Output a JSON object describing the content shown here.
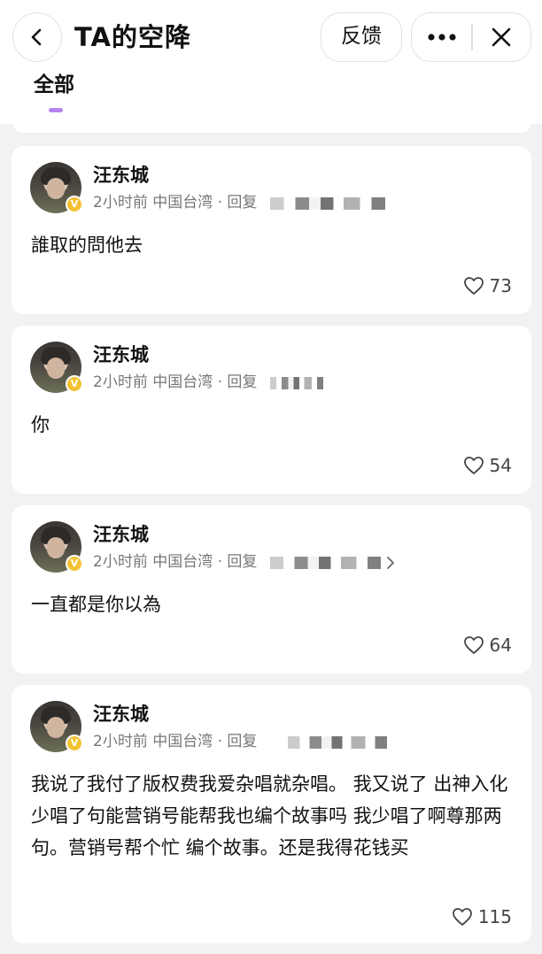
{
  "header": {
    "title": "TA的空降",
    "feedback_label": "反馈",
    "tabs": [
      {
        "label": "全部",
        "active": true
      }
    ]
  },
  "colors": {
    "accent": "#b583ee",
    "badge": "#f3c233",
    "background": "#f2f2f4"
  },
  "comments": [
    {
      "name": "汪东城",
      "meta": "2小时前 中国台湾 · 回复",
      "text": "誰取的問他去",
      "likes": "73"
    },
    {
      "name": "汪东城",
      "meta": "2小时前 中国台湾 · 回复",
      "text": "你",
      "likes": "54"
    },
    {
      "name": "汪东城",
      "meta": "2小时前 中国台湾 · 回复",
      "text": "一直都是你以為",
      "likes": "64"
    },
    {
      "name": "汪东城",
      "meta": "2小时前 中国台湾 · 回复",
      "text": "我说了我付了版权费我爱杂唱就杂唱。 我又说了 出神入化少唱了句能营销号能帮我也编个故事吗 我少唱了啊尊那两句。营销号帮个忙 编个故事。还是我得花钱买",
      "likes": "115"
    }
  ]
}
